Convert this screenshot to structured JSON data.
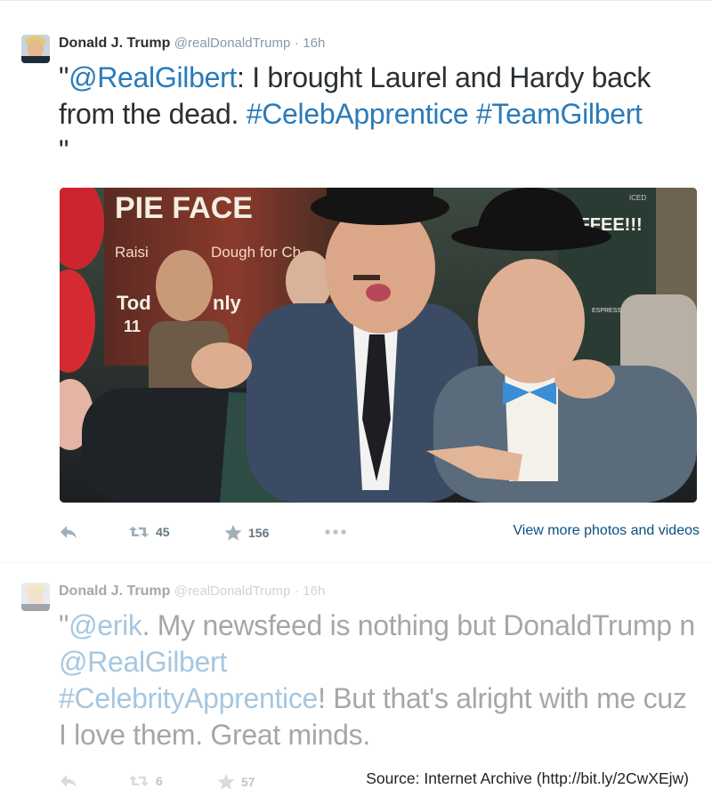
{
  "tweets": [
    {
      "name": "Donald J. Trump",
      "handle": "@realDonaldTrump",
      "separator": "·",
      "time": "16h",
      "text_parts": {
        "quote_open": "\"",
        "mention": "@RealGilbert",
        "body": ": I brought Laurel and Hardy back from the dead. ",
        "hashtag1": "#CelebApprentice",
        "space": " ",
        "hashtag2": "#TeamGilbert",
        "quote_close": "\""
      },
      "actions": {
        "retweets": "45",
        "favorites": "156"
      },
      "view_more": "View more photos and videos",
      "photo": {
        "sign_pie_face": "PIE FACE",
        "sign_raising": "Raisi",
        "sign_dough": "Dough for Ch",
        "sign_today": "Tod",
        "sign_only": "nly",
        "sign_number": "11",
        "sign_coffee": "OFFEE!!!",
        "sign_iced": "ICED",
        "sign_espresso": "ESPRESSO"
      }
    },
    {
      "name": "Donald J. Trump",
      "handle": "@realDonaldTrump",
      "separator": "·",
      "time": "16h",
      "text_parts": {
        "quote_open": "\"",
        "mention1": "@erik",
        "body1": ". My newsfeed is nothing but DonaldTrump n ",
        "mention2": "@RealGilbert",
        "hashtag": "#CelebrityApprentice",
        "body2": "! But that's alright with me cuz I love them. Great minds."
      },
      "actions": {
        "retweets": "6",
        "favorites": "57"
      }
    }
  ],
  "source_caption": "Source: Internet Archive (http://bit.ly/2CwXEjw)",
  "icons": [
    "reply-icon",
    "retweet-icon",
    "favorite-icon",
    "more-icon"
  ],
  "colors": {
    "link": "#2b7bb9",
    "text": "#292f33",
    "meta": "#8899a6",
    "view_more": "#0b4f80"
  }
}
